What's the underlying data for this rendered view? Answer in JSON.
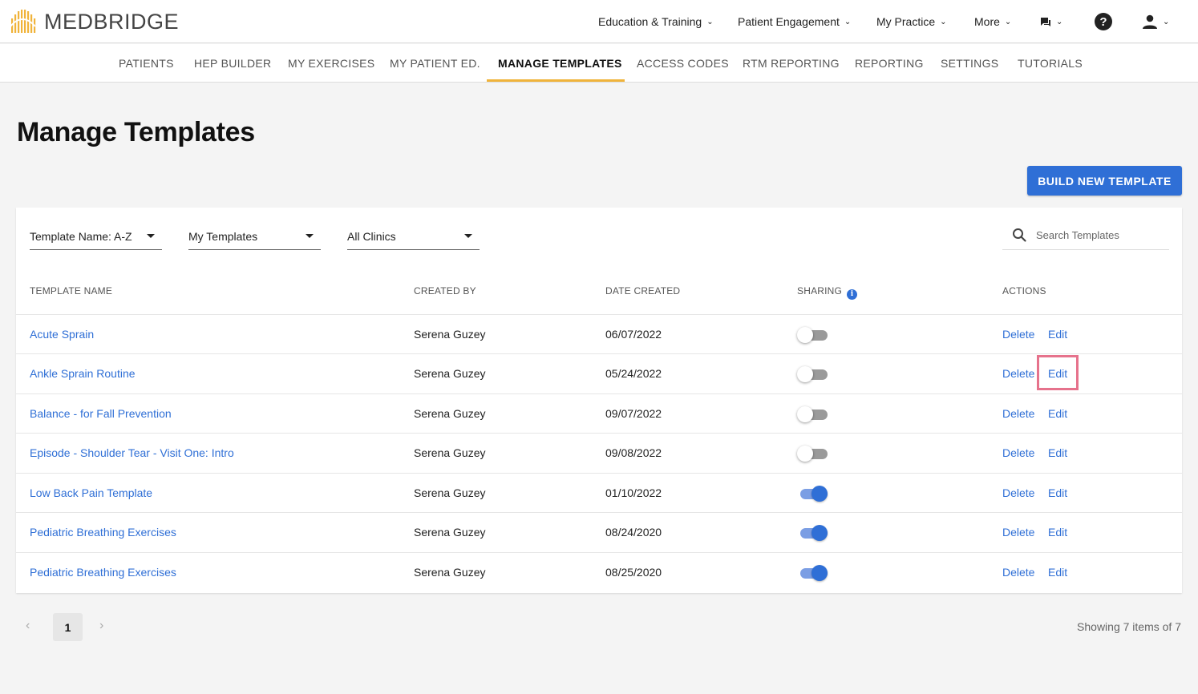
{
  "brand": {
    "name": "MEDBRIDGE"
  },
  "top_nav": [
    {
      "label": "Education & Training",
      "chevron": "⌄"
    },
    {
      "label": "Patient Engagement",
      "chevron": "⌄"
    },
    {
      "label": "My Practice",
      "chevron": "⌄"
    },
    {
      "label": "More",
      "chevron": "⌄"
    }
  ],
  "top_icons": {
    "chat_chevron": "⌄",
    "help_glyph": "?",
    "user_chevron": "⌄"
  },
  "tabs": [
    {
      "label": "PATIENTS"
    },
    {
      "label": "HEP BUILDER"
    },
    {
      "label": "MY EXERCISES"
    },
    {
      "label": "MY PATIENT ED."
    },
    {
      "label": "MANAGE TEMPLATES",
      "active": true
    },
    {
      "label": "ACCESS CODES"
    },
    {
      "label": "RTM REPORTING"
    },
    {
      "label": "REPORTING"
    },
    {
      "label": "SETTINGS"
    },
    {
      "label": "TUTORIALS"
    }
  ],
  "page": {
    "title": "Manage Templates",
    "build_button": "BUILD NEW TEMPLATE"
  },
  "filters": {
    "sort": "Template Name: A-Z",
    "owner": "My Templates",
    "clinic": "All Clinics"
  },
  "search": {
    "placeholder": "Search Templates"
  },
  "table": {
    "headers": {
      "name": "TEMPLATE NAME",
      "created_by": "CREATED BY",
      "date_created": "DATE CREATED",
      "sharing": "SHARING",
      "actions": "ACTIONS"
    },
    "info_glyph": "i",
    "rows": [
      {
        "name": "Acute Sprain",
        "created_by": "Serena Guzey",
        "date": "06/07/2022",
        "sharing": false,
        "delete": "Delete",
        "edit": "Edit"
      },
      {
        "name": "Ankle Sprain Routine",
        "created_by": "Serena Guzey",
        "date": "05/24/2022",
        "sharing": false,
        "delete": "Delete",
        "edit": "Edit"
      },
      {
        "name": "Balance - for Fall Prevention",
        "created_by": "Serena Guzey",
        "date": "09/07/2022",
        "sharing": false,
        "delete": "Delete",
        "edit": "Edit"
      },
      {
        "name": "Episode - Shoulder Tear - Visit One: Intro",
        "created_by": "Serena Guzey",
        "date": "09/08/2022",
        "sharing": false,
        "delete": "Delete",
        "edit": "Edit"
      },
      {
        "name": "Low Back Pain Template",
        "created_by": "Serena Guzey",
        "date": "01/10/2022",
        "sharing": true,
        "delete": "Delete",
        "edit": "Edit"
      },
      {
        "name": "Pediatric Breathing Exercises",
        "created_by": "Serena Guzey",
        "date": "08/24/2020",
        "sharing": true,
        "delete": "Delete",
        "edit": "Edit"
      },
      {
        "name": "Pediatric Breathing Exercises",
        "created_by": "Serena Guzey",
        "date": "08/25/2020",
        "sharing": true,
        "delete": "Delete",
        "edit": "Edit"
      }
    ]
  },
  "pagination": {
    "prev": "‹",
    "current": "1",
    "next": "›",
    "summary": "Showing 7 items of 7"
  },
  "colors": {
    "accent": "#2f6fd6",
    "tab_underline": "#f0b33a",
    "highlight": "#e6728c",
    "logo": "#f0b33a"
  }
}
